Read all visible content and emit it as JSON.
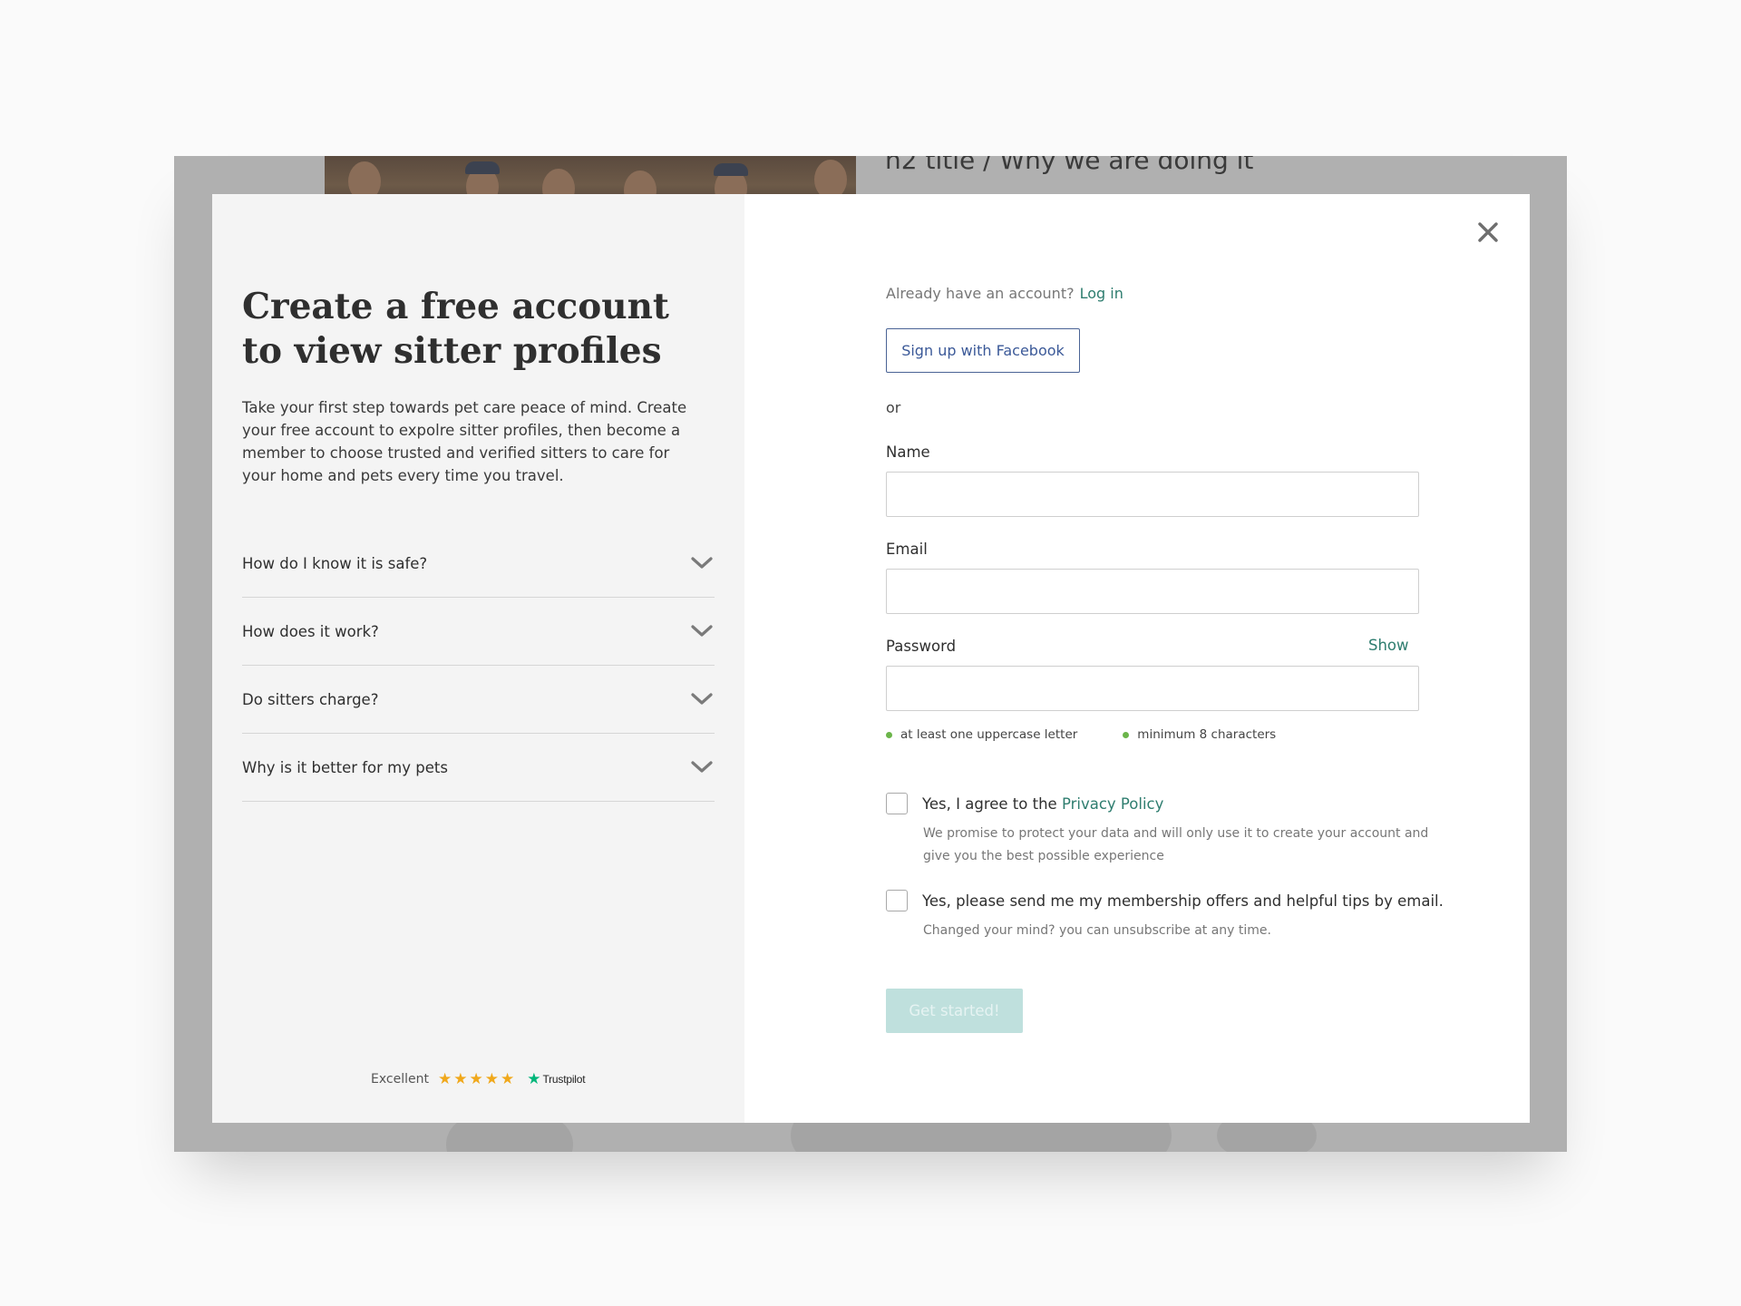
{
  "background": {
    "heading": "h2 title / Why we are doing it"
  },
  "left": {
    "title": "Create a free account to view sitter profiles",
    "intro": "Take your first step towards pet care peace of mind. Create your free account to expolre sitter profiles, then become a member to choose trusted and verified sitters to care for your home and pets every time you travel.",
    "faq": [
      {
        "question": "How do I know it is safe?"
      },
      {
        "question": "How does it work?"
      },
      {
        "question": "Do sitters charge?"
      },
      {
        "question": "Why is it better for my pets"
      }
    ],
    "trust": {
      "rating_text": "Excellent",
      "stars": 5,
      "brand": "Trustpilot",
      "star_color": "#f0a81b",
      "brand_color": "#00b67a"
    }
  },
  "right": {
    "already_text": "Already have an account?",
    "login_link": "Log in",
    "facebook_button": "Sign up with Facebook",
    "or_text": "or",
    "name_label": "Name",
    "name_value": "",
    "email_label": "Email",
    "email_value": "",
    "password_label": "Password",
    "password_value": "",
    "show_link": "Show",
    "password_rules": [
      "at least one uppercase letter",
      "minimum 8 characters"
    ],
    "privacy_prefix": "Yes, I agree to the",
    "privacy_link": "Privacy Policy",
    "privacy_note": "We promise to protect your data and will only use it to create your account and give you the best possible experience",
    "marketing_label": "Yes, please send me my membership offers and helpful tips by email.",
    "marketing_note": "Changed your mind? you can unsubscribe at any time.",
    "submit_button": "Get started!",
    "accent_color": "#2e7d6f",
    "submit_bg": "#bfe0dd"
  }
}
